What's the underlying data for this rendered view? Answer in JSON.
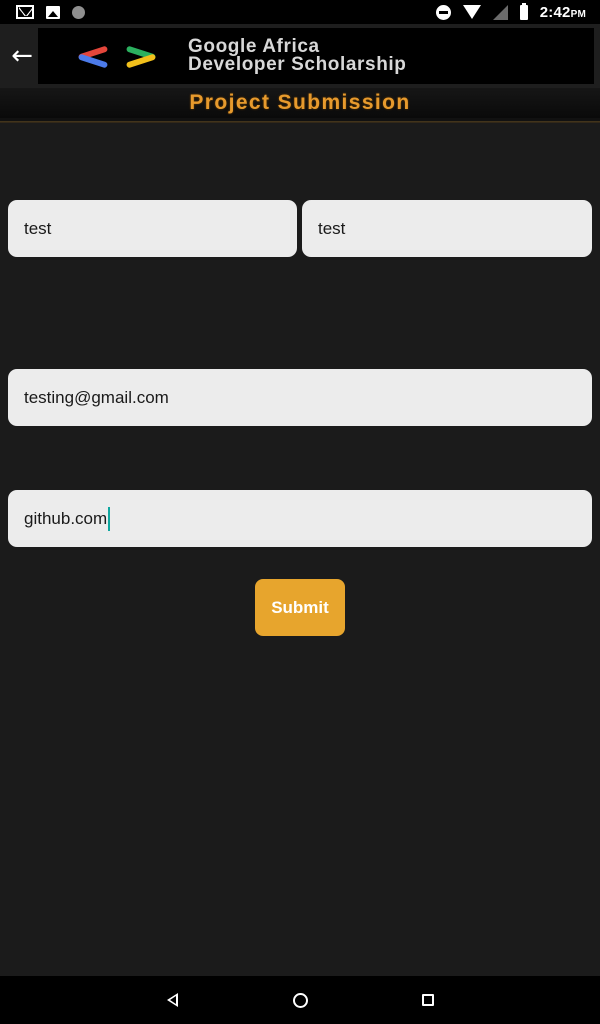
{
  "status_bar": {
    "time": "2:42",
    "ampm": "PM",
    "icons": [
      "gmail-icon",
      "photo-icon",
      "circle-notification-icon",
      "do-not-disturb-icon",
      "wifi-icon",
      "no-signal-icon",
      "battery-icon"
    ]
  },
  "app_bar": {
    "back_icon": "arrow-back-icon",
    "banner_line1": "Google Africa",
    "banner_line2": "Developer Scholarship",
    "subtitle": "Project Submission"
  },
  "form": {
    "first_name": {
      "value": "test"
    },
    "last_name": {
      "value": "test"
    },
    "email": {
      "value": "testing@gmail.com"
    },
    "github": {
      "value": "github.com"
    },
    "submit_label": "Submit"
  },
  "nav_bar": {
    "icons": [
      "nav-back-icon",
      "nav-home-icon",
      "nav-recents-icon"
    ]
  },
  "colors": {
    "background": "#1b1b1b",
    "field": "#ececec",
    "accent": "#e7a52d",
    "cursor": "#0fa7a0"
  }
}
